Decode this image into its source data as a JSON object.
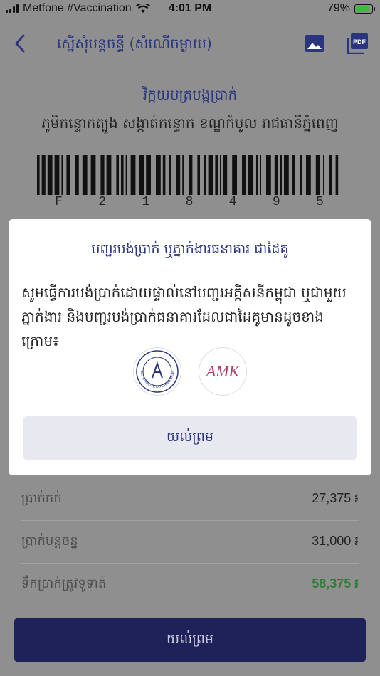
{
  "status_bar": {
    "carrier": "Metfone #Vaccination",
    "time": "4:01 PM",
    "battery": "79%",
    "battery_level": 0.79
  },
  "nav": {
    "title": "ស្នើសុំបន្តចន្ទ្ធី (សំណើចម្ងាយ)",
    "back_icon": "chevron-left-icon",
    "image_icon": "image-icon",
    "pdf_icon": "pdf-icon"
  },
  "receipt": {
    "title": "វិក្កយបត្របង្កប្រាក់",
    "address": "ភូមិកន្ទោកត្បូង សង្កាត់កន្ទោក ខណ្ឌកំបូល រាជធានីភ្នំពេញ",
    "barcode_digits": [
      "F",
      "2",
      "1",
      "8",
      "4",
      "9",
      "5"
    ]
  },
  "modal": {
    "title": "បញ្ជរបង់ប្រាក់ ឬភ្នាក់ងារធនាគារ ជាដៃគូ",
    "message": "សូមធ្វើការបង់ប្រាក់ដោយផ្ទាល់នៅបញ្ជរអគ្គិសនីកម្ពុជា ឬជាមួយភ្នាក់ងារ និងបញ្ជរបង់ប្រាក់ធនាគារដែលជាដៃគូមានដូចខាងក្រោម៖",
    "logos": [
      {
        "name": "edc-logo",
        "caption": "ELECTRICITE DU CAMBODGE"
      },
      {
        "name": "amk-logo",
        "text": "AMK"
      }
    ],
    "confirm_label": "យល់ព្រម"
  },
  "summary": {
    "rows": [
      {
        "label": "ប្រាក់កក់",
        "value": "27,375 ៛"
      },
      {
        "label": "ប្រាក់បន្តចន្ទ្ធ",
        "value": "31,000 ៛"
      },
      {
        "label": "ទឹកប្រាក់ត្រូវទូទាត់",
        "value": "58,375 ៛"
      }
    ]
  },
  "bottom": {
    "confirm_label": "យល់ព្រម"
  },
  "colors": {
    "accent": "#2a3580",
    "primary_button": "#1e2259",
    "total_green": "#2e7d32",
    "overlay": "#8f8f8f"
  }
}
